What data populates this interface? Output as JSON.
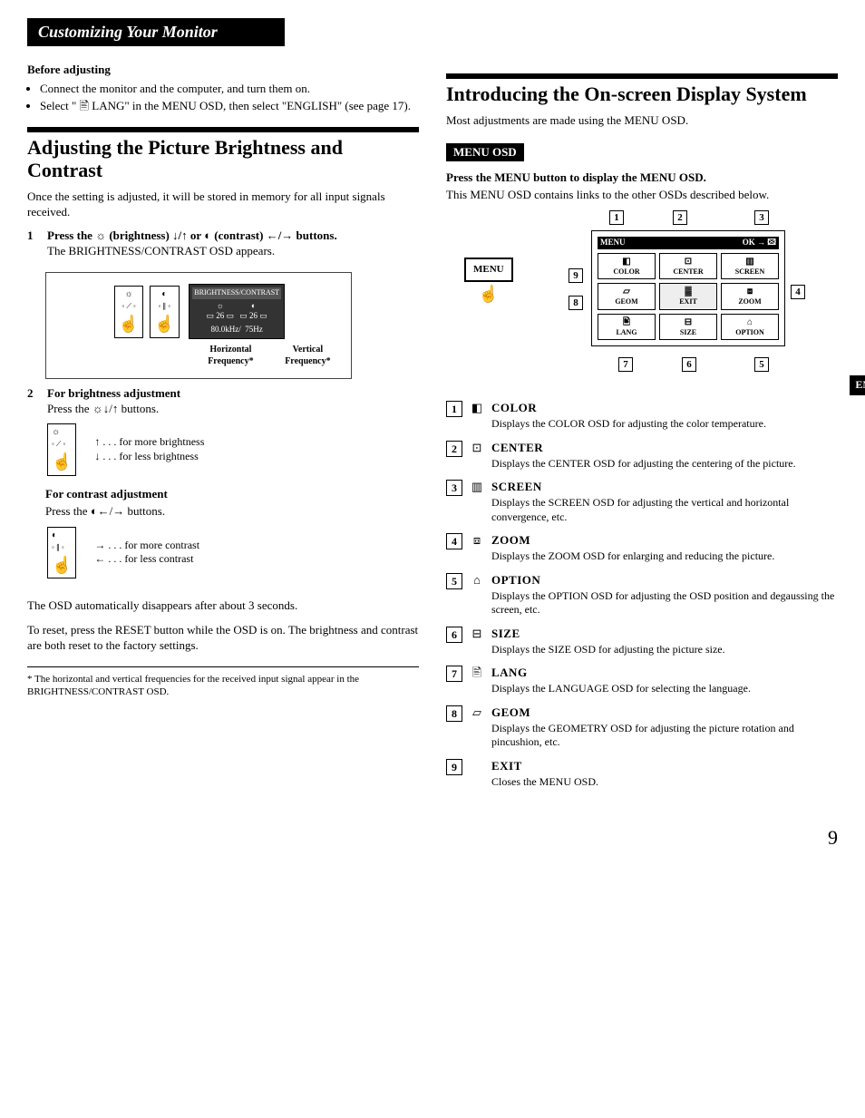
{
  "header": "Customizing Your Monitor",
  "before": {
    "heading": "Before adjusting",
    "items": [
      "Connect the monitor and the computer, and turn them on.",
      "Select \" 🖹 LANG\" in the MENU OSD, then select \"ENGLISH\" (see page 17)."
    ]
  },
  "adjust": {
    "title": "Adjusting the Picture Brightness and Contrast",
    "intro": "Once the setting is adjusted, it will be stored in memory for all input signals received.",
    "step1_title": "Press the ☼ (brightness) ↓/↑ or ◐ (contrast) ←/→ buttons.",
    "step1_sub": "The BRIGHTNESS/CONTRAST OSD appears.",
    "osd_header": "BRIGHTNESS/CONTRAST",
    "osd_val": "26",
    "osd_hfreq": "80.0kHz/",
    "osd_vfreq": "75Hz",
    "freq_h": "Horizontal Frequency*",
    "freq_v": "Vertical Frequency*",
    "step2_title": "For brightness adjustment",
    "step2_sub": "Press the ☼↓/↑ buttons.",
    "more_brightness": "↑ . . . for more brightness",
    "less_brightness": "↓ . . . for less brightness",
    "contrast_title": "For contrast adjustment",
    "contrast_sub": "Press the ◐←/→ buttons.",
    "more_contrast": "→ . . . for more contrast",
    "less_contrast": "← . . . for less contrast",
    "auto_off": "The OSD automatically disappears after about 3 seconds.",
    "reset": "To reset, press the RESET button while the OSD is on. The brightness and contrast are both reset to the factory settings.",
    "footnote": "* The horizontal and vertical frequencies for the received input signal appear in the BRIGHTNESS/CONTRAST OSD."
  },
  "intro_osd": {
    "title": "Introducing the On-screen Display System",
    "para": "Most adjustments are made using the MENU OSD.",
    "menu_label": "MENU OSD",
    "press_line": "Press the MENU button to display the MENU OSD.",
    "desc_line": "This MENU OSD contains links to the other OSDs described below.",
    "menu_button": "MENU",
    "panel_title_left": "MENU",
    "panel_title_right": "OK → 🖾",
    "grid": [
      "COLOR",
      "CENTER",
      "SCREEN",
      "GEOM",
      "EXIT",
      "ZOOM",
      "LANG",
      "SIZE",
      "OPTION"
    ],
    "en_tab": "EN",
    "callouts": [
      "1",
      "2",
      "3",
      "4",
      "5",
      "6",
      "7",
      "8",
      "9"
    ]
  },
  "osd_items": [
    {
      "num": "1",
      "icon": "◧",
      "title": "COLOR",
      "desc": "Displays the COLOR OSD for adjusting the color temperature."
    },
    {
      "num": "2",
      "icon": "⊡",
      "title": "CENTER",
      "desc": "Displays the CENTER OSD for adjusting the centering of the picture."
    },
    {
      "num": "3",
      "icon": "▥",
      "title": "SCREEN",
      "desc": "Displays the SCREEN OSD for adjusting the vertical and horizontal convergence, etc."
    },
    {
      "num": "4",
      "icon": "⧈",
      "title": "ZOOM",
      "desc": "Displays the ZOOM OSD for enlarging and reducing the picture."
    },
    {
      "num": "5",
      "icon": "⌂",
      "title": "OPTION",
      "desc": "Displays the OPTION OSD for adjusting the OSD position and degaussing the screen, etc."
    },
    {
      "num": "6",
      "icon": "⊟",
      "title": "SIZE",
      "desc": "Displays the SIZE OSD for adjusting the picture size."
    },
    {
      "num": "7",
      "icon": "🖹",
      "title": "LANG",
      "desc": "Displays the LANGUAGE OSD for selecting the language."
    },
    {
      "num": "8",
      "icon": "▱",
      "title": "GEOM",
      "desc": "Displays the GEOMETRY OSD for adjusting the picture rotation and pincushion, etc."
    },
    {
      "num": "9",
      "icon": "",
      "title": "EXIT",
      "desc": "Closes the MENU OSD."
    }
  ],
  "page_number": "9"
}
